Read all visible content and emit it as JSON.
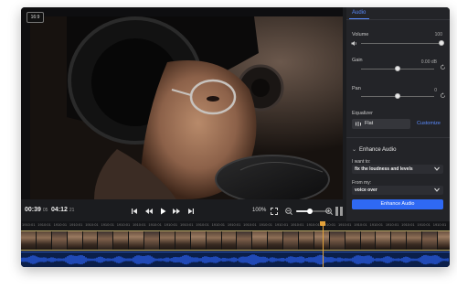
{
  "preview": {
    "aspect_ratio": "16:9"
  },
  "transport": {
    "current_time": "00:39",
    "current_frames": "05",
    "total_time": "04:12",
    "total_frames": "21",
    "zoom": "100%",
    "zoom_level": 0.4
  },
  "panel": {
    "tab": "Audio",
    "volume": {
      "label": "Volume",
      "value": "100",
      "level": 1.0
    },
    "gain": {
      "label": "Gain",
      "value": "0.00 dB",
      "level": 0.5
    },
    "pan": {
      "label": "Pan",
      "value": "0",
      "level": 0.5
    },
    "equalizer": {
      "label": "Equalizer",
      "preset": "Flat",
      "customize": "Customize"
    },
    "enhance": {
      "title": "Enhance Audio",
      "want_label": "I want to:",
      "want_value": "fix the loudness and levels",
      "from_label": "From my:",
      "from_value": "voice over",
      "button": "Enhance Audio"
    }
  },
  "timeline": {
    "ruler_label": "1910:01"
  },
  "colors": {
    "accent": "#2f69f3",
    "link": "#5b8cff",
    "playhead": "#e3a23a",
    "audio": "#2e66ff"
  }
}
